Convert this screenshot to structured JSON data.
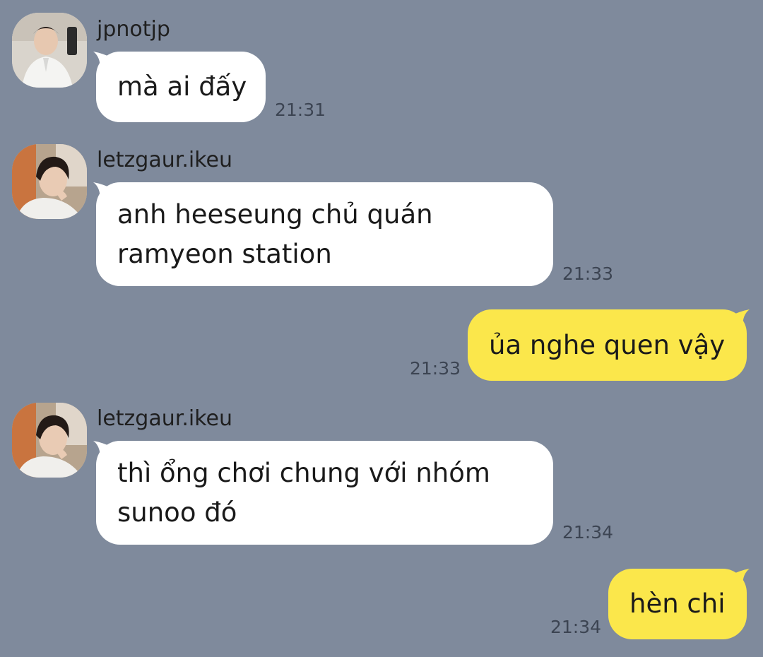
{
  "colors": {
    "background": "#7f8a9c",
    "incoming_bubble": "#ffffff",
    "outgoing_bubble": "#fbe74b",
    "timestamp": "#3c4452"
  },
  "messages": [
    {
      "sender": "jpnotjp",
      "direction": "incoming",
      "avatar": "profile-photo",
      "lines": [
        "mà ai đấy"
      ],
      "time": "21:31"
    },
    {
      "sender": "letzgaur.ikeu",
      "direction": "incoming",
      "avatar": "profile-photo",
      "lines": [
        "anh heeseung chủ quán",
        "ramyeon station"
      ],
      "time": "21:33"
    },
    {
      "direction": "outgoing",
      "lines": [
        "ủa nghe quen vậy"
      ],
      "time": "21:33"
    },
    {
      "sender": "letzgaur.ikeu",
      "direction": "incoming",
      "avatar": "profile-photo",
      "lines": [
        "thì ổng chơi chung với nhóm",
        "sunoo đó"
      ],
      "time": "21:34"
    },
    {
      "direction": "outgoing",
      "lines": [
        "hèn chi"
      ],
      "time": "21:34"
    }
  ]
}
